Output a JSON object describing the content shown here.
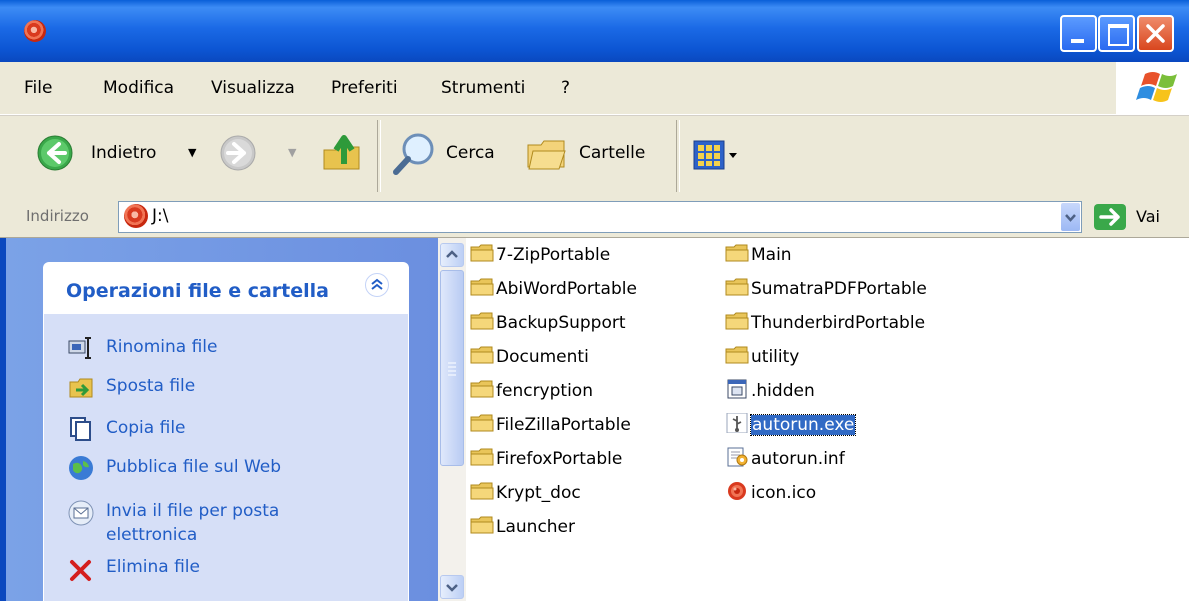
{
  "window": {
    "title": ""
  },
  "menu": {
    "items": [
      "File",
      "Modifica",
      "Visualizza",
      "Preferiti",
      "Strumenti",
      "?"
    ]
  },
  "toolbar": {
    "back_label": "Indietro",
    "search_label": "Cerca",
    "folders_label": "Cartelle"
  },
  "address": {
    "label": "Indirizzo",
    "value": "J:\\",
    "go_label": "Vai"
  },
  "tasks": {
    "title": "Operazioni file e cartella",
    "items": [
      {
        "label": "Rinomina file",
        "icon": "rename-icon"
      },
      {
        "label": "Sposta file",
        "icon": "move-icon"
      },
      {
        "label": "Copia file",
        "icon": "copy-icon"
      },
      {
        "label": "Pubblica file sul Web",
        "icon": "publish-web-icon"
      },
      {
        "label": "Invia il file per posta elettronica",
        "icon": "email-icon"
      },
      {
        "label": "Elimina file",
        "icon": "delete-icon"
      }
    ]
  },
  "files": {
    "col1": [
      "7-ZipPortable",
      "AbiWordPortable",
      "BackupSupport",
      "Documenti",
      "fencryption",
      "FileZillaPortable",
      "FirefoxPortable",
      "Krypt_doc",
      "Launcher"
    ],
    "col2": [
      {
        "name": "Main",
        "icon": "folder-icon"
      },
      {
        "name": "SumatraPDFPortable",
        "icon": "folder-icon"
      },
      {
        "name": "ThunderbirdPortable",
        "icon": "folder-icon"
      },
      {
        "name": "utility",
        "icon": "folder-icon"
      },
      {
        "name": ".hidden",
        "icon": "text-file-icon"
      },
      {
        "name": "autorun.exe",
        "icon": "usb-icon",
        "selected": true
      },
      {
        "name": "autorun.inf",
        "icon": "config-file-icon"
      },
      {
        "name": "icon.ico",
        "icon": "app-ico-icon"
      }
    ]
  },
  "colors": {
    "titlebar": "#0a5fd8",
    "task_link": "#215dc6",
    "selection": "#316ac5"
  }
}
